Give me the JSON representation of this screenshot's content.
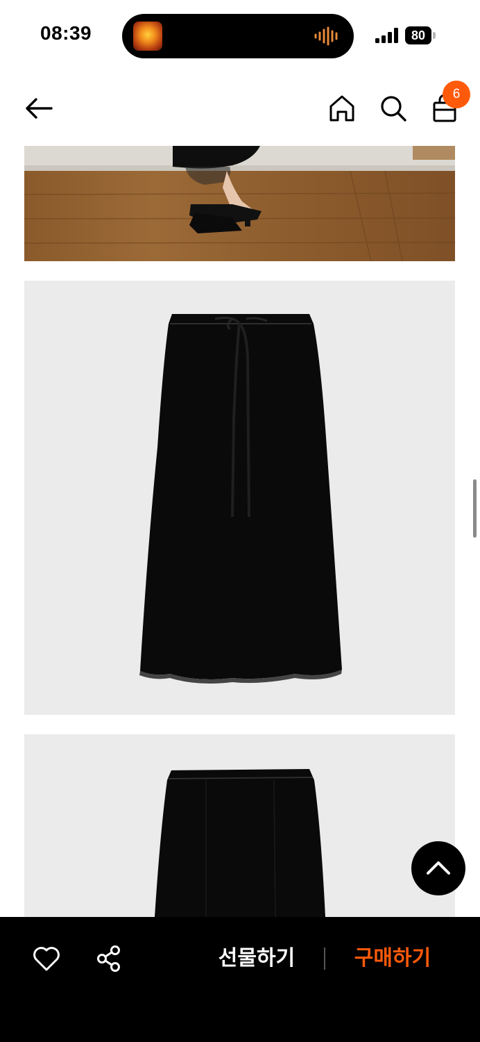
{
  "status_bar": {
    "time": "08:39",
    "battery": "80",
    "icons": [
      "now-playing-artwork",
      "audio-waveform-icon",
      "cellular-signal-icon",
      "battery-icon"
    ]
  },
  "nav": {
    "icons": [
      "back-arrow-icon",
      "home-icon",
      "search-icon",
      "shopping-bag-icon"
    ],
    "cart_count": "6"
  },
  "images": [
    {
      "name": "model-photo-legs",
      "description_icon": "photo"
    },
    {
      "name": "product-photo-skirt-front",
      "description_icon": "photo"
    },
    {
      "name": "product-photo-skirt-back",
      "description_icon": "photo"
    }
  ],
  "bottom_bar": {
    "like_icon": "heart-icon",
    "share_icon": "share-icon",
    "gift_label": "선물하기",
    "buy_label": "구매하기"
  },
  "colors": {
    "accent": "#ff5a0a",
    "bar_background": "#000000",
    "image_background": "#ebebeb"
  },
  "scroll_top_icon": "chevron-up-icon"
}
